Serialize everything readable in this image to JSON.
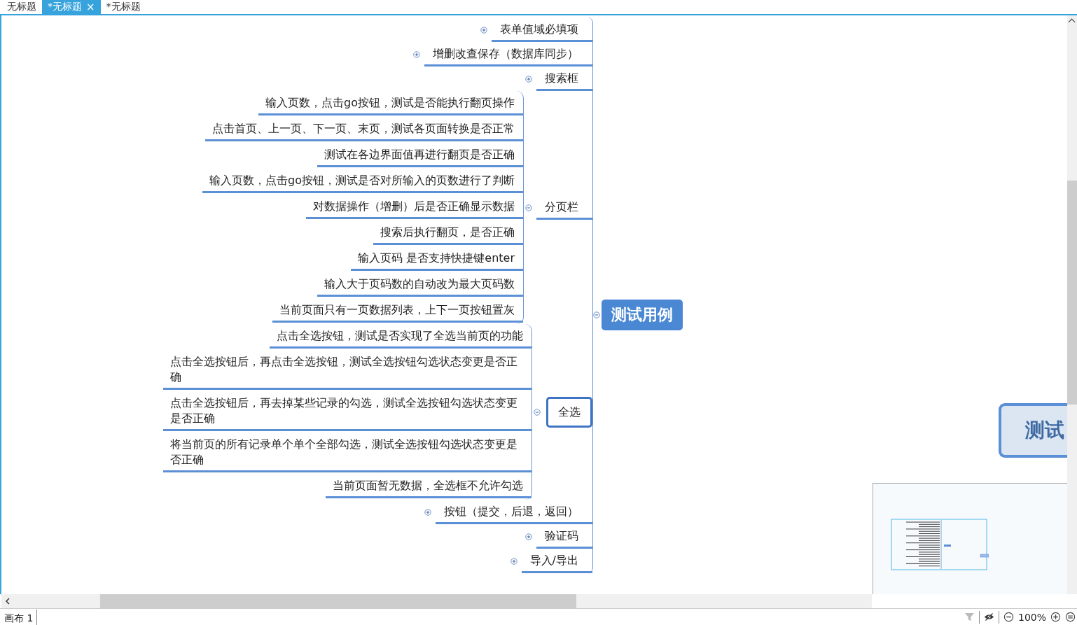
{
  "tabs": [
    {
      "label": "无标题",
      "selected": false
    },
    {
      "label": "*无标题",
      "selected": true,
      "close": "×"
    },
    {
      "label": "*无标题",
      "selected": false
    }
  ],
  "map": {
    "central": {
      "label": "测试用例",
      "expanded": true
    },
    "topics": [
      {
        "label": "表单值域必填项",
        "expanded": false,
        "selected": false
      },
      {
        "label": "增删改查保存（数据库同步）",
        "expanded": false,
        "selected": false
      },
      {
        "label": "搜索框",
        "expanded": false,
        "selected": false
      },
      {
        "label": "分页栏",
        "expanded": true,
        "selected": false,
        "children": [
          {
            "label": "输入页数，点击go按钮，测试是否能执行翻页操作"
          },
          {
            "label": "点击首页、上一页、下一页、末页，测试各页面转换是否正常"
          },
          {
            "label": "测试在各边界面值再进行翻页是否正确"
          },
          {
            "label": "输入页数，点击go按钮，测试是否对所输入的页数进行了判断"
          },
          {
            "label": "对数据操作（增删）后是否正确显示数据"
          },
          {
            "label": "搜索后执行翻页，是否正确"
          },
          {
            "label": "输入页码 是否支持快捷键enter"
          },
          {
            "label": "输入大于页码数的自动改为最大页码数"
          },
          {
            "label": "当前页面只有一页数据列表，上下一页按钮置灰"
          }
        ]
      },
      {
        "label": "全选",
        "expanded": true,
        "selected": true,
        "children": [
          {
            "label": "点击全选按钮，测试是否实现了全选当前页的功能"
          },
          {
            "label": "点击全选按钮后，再点击全选按钮，测试全选按钮勾选状态变更是否正确"
          },
          {
            "label": "点击全选按钮后，再去掉某些记录的勾选，测试全选按钮勾选状态变更是否正确"
          },
          {
            "label": "将当前页的所有记录单个单个全部勾选，测试全选按钮勾选状态变更是否正确"
          },
          {
            "label": "当前页面暂无数据，全选框不允许勾选"
          }
        ]
      },
      {
        "label": "按钮（提交，后退，返回）",
        "expanded": false,
        "selected": false
      },
      {
        "label": "验证码",
        "expanded": false,
        "selected": false
      },
      {
        "label": "导入/导出",
        "expanded": false,
        "selected": false
      }
    ],
    "floating_topic": {
      "label": "测试"
    }
  },
  "sheet_tab": {
    "label": "画布 1"
  },
  "status_bar": {
    "zoom": "100%"
  }
}
